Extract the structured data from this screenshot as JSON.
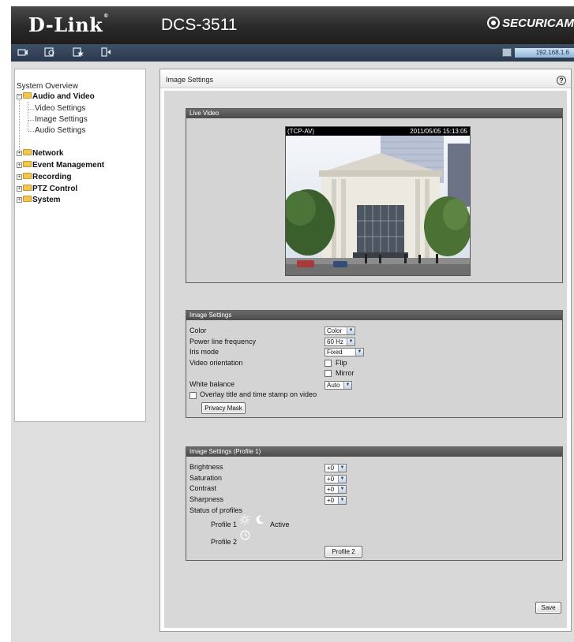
{
  "header": {
    "logo": "D-Link",
    "logo_mark": "®",
    "model": "DCS-3511",
    "brand": "SECURICAM"
  },
  "toolbar": {
    "icons": [
      "camera-icon",
      "live-view-icon",
      "setup-icon",
      "logout-icon"
    ],
    "ip": "192.168.1.6"
  },
  "sidebar": {
    "overview": "System Overview",
    "audio_video": {
      "label": "Audio and Video",
      "items": [
        "Video Settings",
        "Image Settings",
        "Audio Settings"
      ]
    },
    "categories": [
      "Network",
      "Event Management",
      "Recording",
      "PTZ Control",
      "System"
    ],
    "expand_symbol": "+",
    "collapse_symbol": "−"
  },
  "main": {
    "title": "Image Settings",
    "help": "?",
    "live_video": {
      "title": "Live Video",
      "protocol": "(TCP-AV)",
      "timestamp": "2011/05/05 15:13:05"
    },
    "image_settings": {
      "title": "Image Settings",
      "color_label": "Color",
      "color_value": "Color",
      "power_label": "Power line frequency",
      "power_value": "60 Hz",
      "iris_label": "Iris mode",
      "iris_value": "Fixed",
      "orientation_label": "Video orientation",
      "flip_label": "Flip",
      "mirror_label": "Mirror",
      "wb_label": "White balance",
      "wb_value": "Auto",
      "overlay_label": "Overlay title and time stamp on video",
      "privacy_button": "Privacy Mask"
    },
    "profile_settings": {
      "title": "Image Settings (Profile 1)",
      "brightness_label": "Brightness",
      "brightness_value": "+0",
      "saturation_label": "Saturation",
      "saturation_value": "+0",
      "contrast_label": "Contrast",
      "contrast_value": "+0",
      "sharpness_label": "Sharpness",
      "sharpness_value": "+0",
      "status_label": "Status of profiles",
      "profile1_label": "Profile 1",
      "profile1_status": "Active",
      "profile2_label": "Profile 2",
      "profile2_button": "Profile 2"
    },
    "save_button": "Save"
  }
}
